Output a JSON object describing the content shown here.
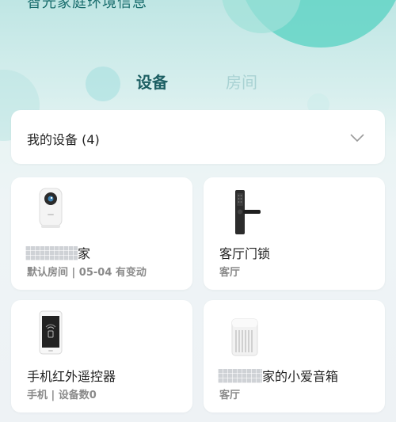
{
  "header": {
    "banner_text": "智光家庭环境信息"
  },
  "tabs": [
    {
      "label": "设备",
      "active": true
    },
    {
      "label": "房间",
      "active": false
    }
  ],
  "device_selector": {
    "label": "我的设备 (4)"
  },
  "devices": [
    {
      "name_suffix": "家",
      "subtitle": "默认房间 | 05-04 有变动",
      "icon": "smart-camera-icon"
    },
    {
      "name": "客厅门锁",
      "subtitle": "客厅",
      "icon": "door-lock-icon"
    },
    {
      "name": "手机红外遥控器",
      "subtitle": "手机 | 设备数0",
      "icon": "phone-remote-icon"
    },
    {
      "name_suffix": "家的小爱音箱",
      "subtitle": "客厅",
      "icon": "smart-speaker-icon"
    }
  ],
  "colors": {
    "accent": "#1d5f63",
    "inactive_tab": "#a9d2d3",
    "bubble": "#55d2c2"
  }
}
